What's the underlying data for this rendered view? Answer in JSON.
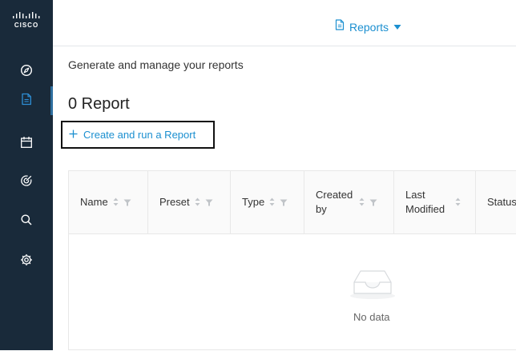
{
  "brand": {
    "logo_text": "CISCO"
  },
  "sidebar": {
    "items": [
      {
        "icon": "compass-icon",
        "label": "Explore"
      },
      {
        "icon": "report-doc-icon",
        "label": "Reports",
        "active": true
      },
      {
        "icon": "calendar-icon",
        "label": "Calendar"
      },
      {
        "icon": "target-icon",
        "label": "Targets"
      },
      {
        "icon": "search-icon",
        "label": "Search"
      },
      {
        "icon": "gear-icon",
        "label": "Settings"
      }
    ]
  },
  "topbar": {
    "title": "Reports",
    "dropdown_icon": "caret-down-icon"
  },
  "main": {
    "subtitle": "Generate and manage your reports",
    "heading": "0 Report",
    "create_label": "Create and run a Report"
  },
  "table": {
    "columns": [
      "Name",
      "Preset",
      "Type",
      "Created by",
      "Last Modified",
      "Status"
    ],
    "empty_text": "No data"
  },
  "colors": {
    "sidebar_bg": "#192a3a",
    "accent": "#1b8fd0"
  }
}
